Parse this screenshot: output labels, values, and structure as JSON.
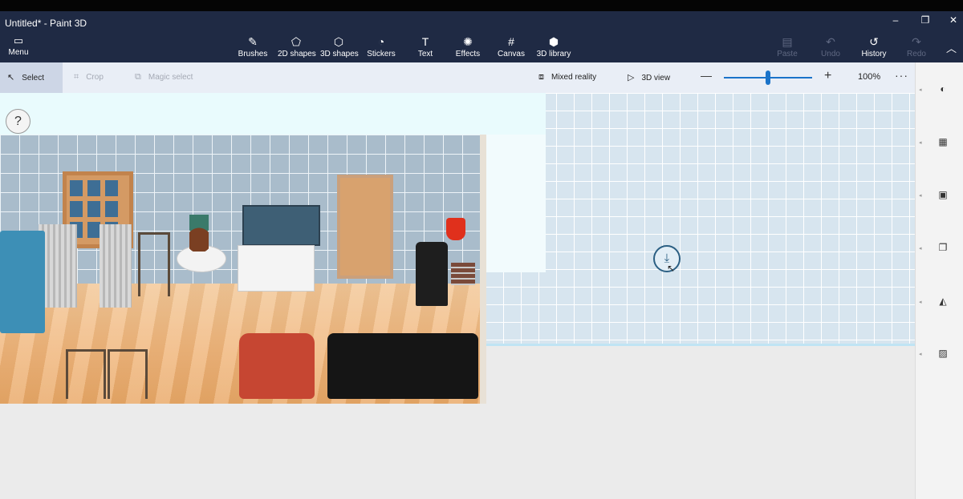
{
  "window": {
    "title": "Untitled* - Paint 3D",
    "minimize_glyph": "–",
    "maximize_glyph": "❐",
    "close_glyph": "✕"
  },
  "ribbon": {
    "menu": {
      "label": "Menu",
      "icon": "folder-icon",
      "glyph": "▭"
    },
    "tools": [
      {
        "label": "Brushes",
        "icon": "brush-icon",
        "glyph": "✎"
      },
      {
        "label": "2D shapes",
        "icon": "2d-shapes-icon",
        "glyph": "⬠"
      },
      {
        "label": "3D shapes",
        "icon": "3d-shapes-icon",
        "glyph": "⬡"
      },
      {
        "label": "Stickers",
        "icon": "stickers-icon",
        "glyph": "◔"
      },
      {
        "label": "Text",
        "icon": "text-icon",
        "glyph": "T"
      },
      {
        "label": "Effects",
        "icon": "effects-icon",
        "glyph": "✺"
      },
      {
        "label": "Canvas",
        "icon": "canvas-icon",
        "glyph": "#"
      },
      {
        "label": "3D library",
        "icon": "3d-library-icon",
        "glyph": "⬢"
      }
    ],
    "actions": [
      {
        "label": "Paste",
        "icon": "paste-icon",
        "glyph": "▤",
        "enabled": false
      },
      {
        "label": "Undo",
        "icon": "undo-icon",
        "glyph": "↶",
        "enabled": false
      },
      {
        "label": "History",
        "icon": "history-icon",
        "glyph": "↺",
        "enabled": true
      },
      {
        "label": "Redo",
        "icon": "redo-icon",
        "glyph": "↷",
        "enabled": false
      }
    ],
    "collapse_glyph": "︿"
  },
  "toolbar": {
    "select": {
      "label": "Select",
      "glyph": "↖"
    },
    "crop": {
      "label": "Crop",
      "glyph": "⌗"
    },
    "magic_select": {
      "label": "Magic select",
      "glyph": "⧉"
    },
    "mixed_reality": {
      "label": "Mixed reality",
      "glyph": "⧈"
    },
    "view_3d": {
      "label": "3D view",
      "glyph": "▷"
    },
    "zoom": {
      "minus": "—",
      "plus": "+",
      "percent": "100%",
      "level": 0.5
    },
    "more_glyph": "···"
  },
  "side_panel": {
    "icons": [
      {
        "name": "palette-icon",
        "glyph": "◐"
      },
      {
        "name": "grid-icon",
        "glyph": "▦"
      },
      {
        "name": "frame-icon",
        "glyph": "▣"
      },
      {
        "name": "copy-icon",
        "glyph": "❐"
      },
      {
        "name": "flip-icon",
        "glyph": "◭"
      },
      {
        "name": "texture-icon",
        "glyph": "▨"
      }
    ],
    "arrow_glyph": "◂"
  },
  "canvas": {
    "help_glyph": "?",
    "floating_icon_glyph": "⤓",
    "cursor_glyph": "↖"
  }
}
